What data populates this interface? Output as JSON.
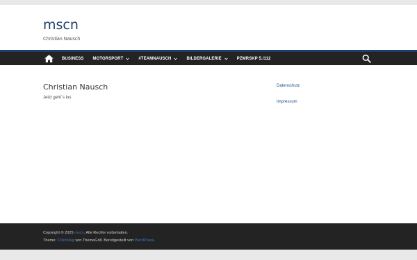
{
  "site": {
    "title": "mscn",
    "tagline": "Christian Nausch"
  },
  "nav": {
    "items": [
      {
        "label": "BUSINESS",
        "dropdown": false
      },
      {
        "label": "MOTORSPORT",
        "dropdown": true
      },
      {
        "label": "#TEAMNAUSCH",
        "dropdown": true
      },
      {
        "label": "BILDERGALERIE",
        "dropdown": true
      },
      {
        "label": "PZMRSKP 5./112",
        "dropdown": false
      }
    ],
    "home_icon": "home-icon",
    "search_icon": "search-icon"
  },
  "main": {
    "title": "Christian Nausch",
    "text": "Jetzt geht´s los"
  },
  "sidebar": {
    "links": [
      "Datenschutz",
      "Impressum"
    ]
  },
  "footer": {
    "copyright_prefix": "Copyright © 2025",
    "copyright_link": "mscn",
    "copyright_suffix": ". Alle Rechte vorbehalten.",
    "theme_prefix": "Theme:",
    "theme_link": "ColorMag",
    "theme_mid": "von ThemeGrill. Bereitgestellt von",
    "wp_link": "WordPress",
    "theme_suffix": "."
  },
  "colors": {
    "accent": "#1f3d6b",
    "nav_bg": "#232323",
    "link": "#1f4e8c"
  }
}
